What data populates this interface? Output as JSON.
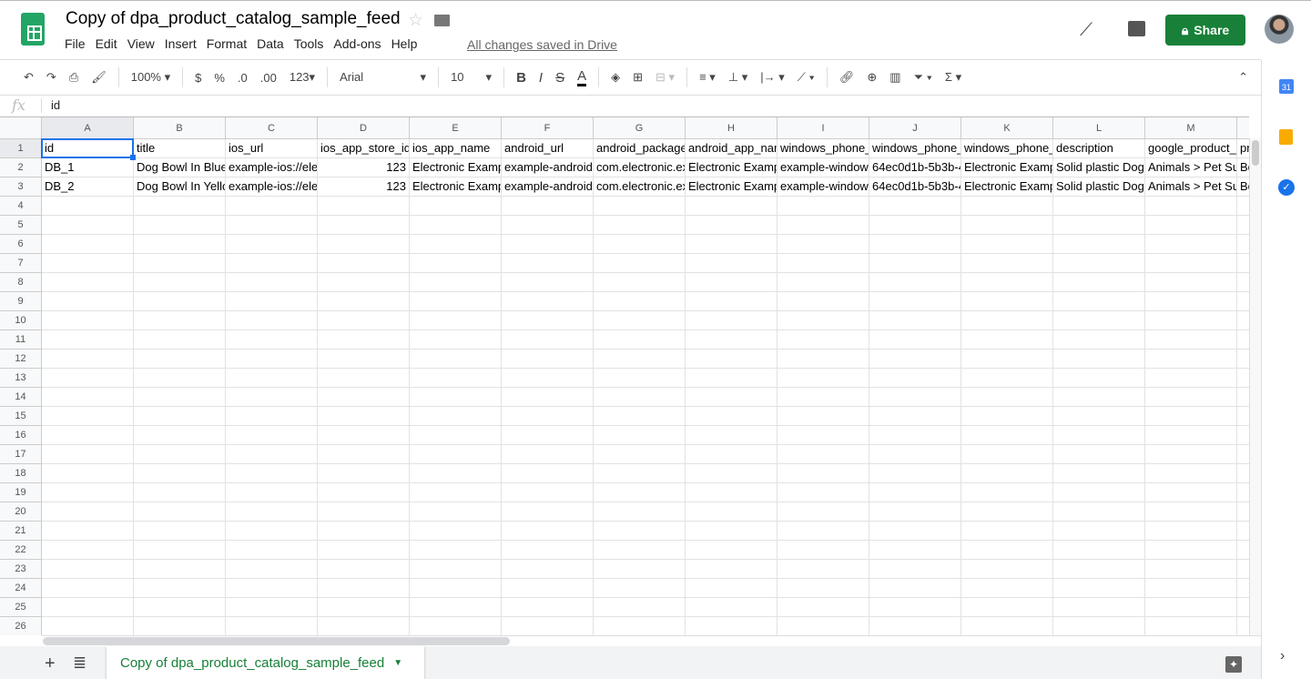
{
  "app": {
    "title": "Copy of dpa_product_catalog_sample_feed",
    "save_status": "All changes saved in Drive",
    "share_label": "Share",
    "menu": [
      "File",
      "Edit",
      "View",
      "Insert",
      "Format",
      "Data",
      "Tools",
      "Add-ons",
      "Help"
    ]
  },
  "toolbar": {
    "zoom": "100%",
    "currency": "$",
    "percent": "%",
    "dec_decrease": ".0",
    "dec_increase": ".00",
    "number_format": "123",
    "font": "Arial",
    "font_size": "10",
    "bold": "B",
    "italic": "I",
    "strike": "S",
    "text_color": "A",
    "sum": "Σ"
  },
  "formula_bar": {
    "label": "fx",
    "value": "id"
  },
  "sheet": {
    "columns": [
      "A",
      "B",
      "C",
      "D",
      "E",
      "F",
      "G",
      "H",
      "I",
      "J",
      "K",
      "L",
      "M",
      ""
    ],
    "row_count": 26,
    "rows": [
      [
        "id",
        "title",
        "ios_url",
        "ios_app_store_id",
        "ios_app_name",
        "android_url",
        "android_package",
        "android_app_name",
        "windows_phone_",
        "windows_phone_",
        "windows_phone_",
        "description",
        "google_product_",
        "pr"
      ],
      [
        "DB_1",
        "Dog Bowl In Blue",
        "example-ios://ele",
        "123",
        "Electronic Example",
        "example-android",
        "com.electronic.ex",
        "Electronic Example",
        "example-window",
        "64ec0d1b-5b3b-4",
        "Electronic Example",
        "Solid plastic Dog",
        "Animals > Pet Su",
        "Bo"
      ],
      [
        "DB_2",
        "Dog Bowl In Yellow",
        "example-ios://ele",
        "123",
        "Electronic Example",
        "example-android",
        "com.electronic.ex",
        "Electronic Example",
        "example-window",
        "64ec0d1b-5b3b-4",
        "Electronic Example",
        "Solid plastic Dog",
        "Animals > Pet Su",
        "Bo"
      ]
    ],
    "selected_cell": "A1"
  },
  "tabs": {
    "active": "Copy of dpa_product_catalog_sample_feed"
  },
  "side_panel": {
    "calendar": "31"
  },
  "colors": {
    "accent": "#188038",
    "selection": "#1a73e8"
  }
}
